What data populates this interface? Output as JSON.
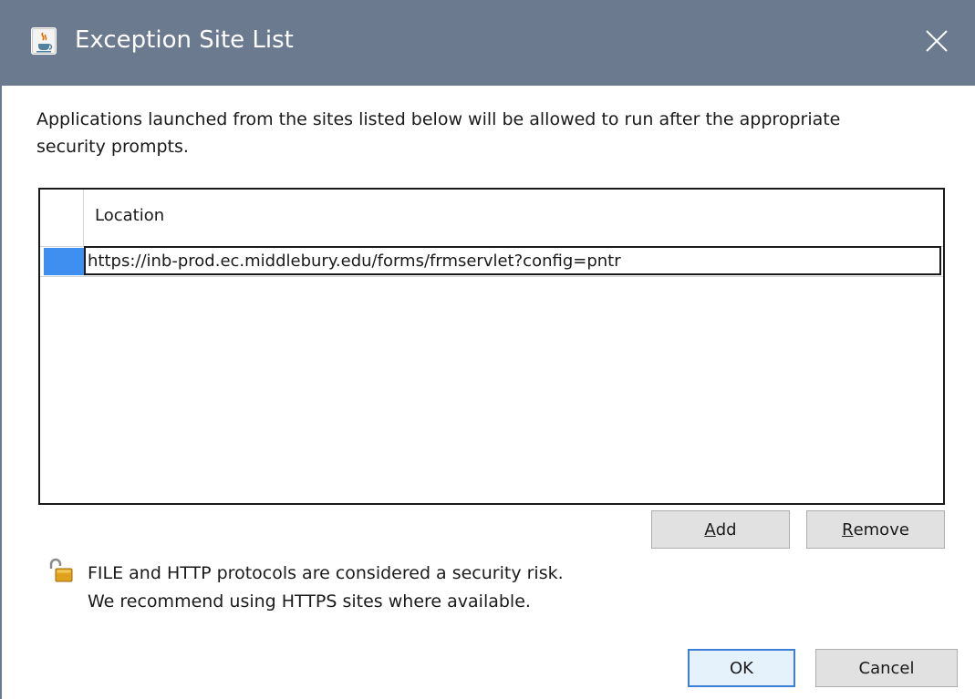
{
  "window": {
    "title": "Exception Site List",
    "app_icon": "java-cup-icon",
    "close_icon": "close-icon"
  },
  "intro_text": "Applications launched from the sites listed below will be allowed to run after the appropriate security prompts.",
  "table": {
    "columns": [
      "Location"
    ],
    "rows": [
      {
        "location": "https://inb-prod.ec.middlebury.edu/forms/frmservlet?config=pntr",
        "selected": true
      }
    ]
  },
  "buttons": {
    "add": {
      "mnemonic": "A",
      "rest": "dd"
    },
    "remove": {
      "mnemonic": "R",
      "rest": "emove"
    },
    "ok": "OK",
    "cancel": "Cancel"
  },
  "warning": {
    "icon": "unlocked-padlock-icon",
    "line1": "FILE and HTTP protocols are considered a security risk.",
    "line2": "We recommend using HTTPS sites where available."
  },
  "colors": {
    "titlebar": "#6b7a8f",
    "selection": "#3f8ff0",
    "button_face": "#e1e1e1",
    "default_button_border": "#3b7fd6"
  }
}
